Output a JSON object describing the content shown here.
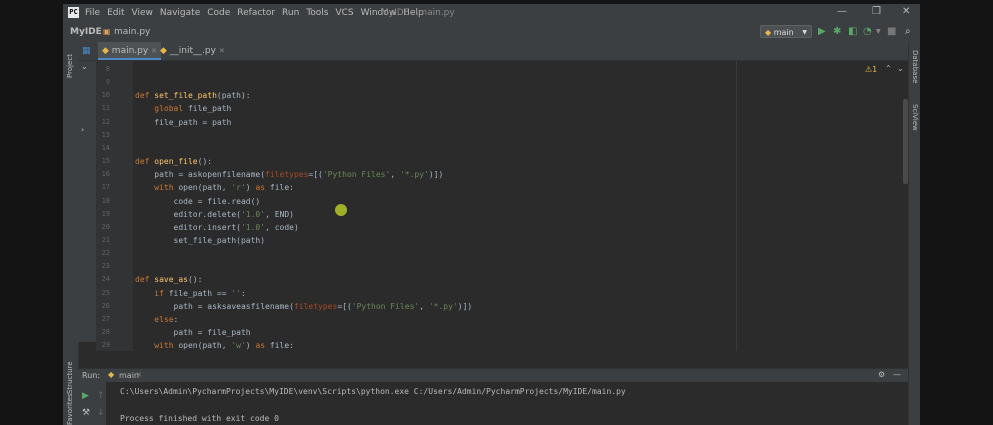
{
  "app": {
    "logo": "PC",
    "menu": [
      "File",
      "Edit",
      "View",
      "Navigate",
      "Code",
      "Refactor",
      "Run",
      "Tools",
      "VCS",
      "Window",
      "Help"
    ],
    "window_title": "MyIDE - main.py",
    "controls": {
      "minimize": "—",
      "maximize": "❐",
      "close": "✕"
    }
  },
  "navbar": {
    "project": "MyIDE",
    "file": "main.py",
    "run_config": "main"
  },
  "side": {
    "left_top": "Project",
    "left_bottom_1": "Structure",
    "left_bottom_2": "Favorites",
    "right_1": "Database",
    "right_2": "SciView"
  },
  "tabs": [
    {
      "label": "main.py"
    },
    {
      "label": "__init__.py"
    }
  ],
  "editor": {
    "inspection": "⚠1",
    "lines": [
      {
        "n": "8",
        "segs": []
      },
      {
        "n": "9",
        "segs": []
      },
      {
        "n": "10",
        "segs": [
          {
            "t": "def ",
            "c": "kw"
          },
          {
            "t": "set_file_path",
            "c": "fn"
          },
          {
            "t": "(path):",
            "c": ""
          }
        ]
      },
      {
        "n": "11",
        "segs": [
          {
            "t": "    ",
            "c": ""
          },
          {
            "t": "global ",
            "c": "kw"
          },
          {
            "t": "file_path",
            "c": ""
          }
        ]
      },
      {
        "n": "12",
        "segs": [
          {
            "t": "    file_path = path",
            "c": ""
          }
        ]
      },
      {
        "n": "13",
        "segs": []
      },
      {
        "n": "14",
        "segs": []
      },
      {
        "n": "15",
        "segs": [
          {
            "t": "def ",
            "c": "kw"
          },
          {
            "t": "open_file",
            "c": "fn"
          },
          {
            "t": "():",
            "c": ""
          }
        ]
      },
      {
        "n": "16",
        "segs": [
          {
            "t": "    path = askopenfilename(",
            "c": ""
          },
          {
            "t": "filetypes",
            "c": "pm"
          },
          {
            "t": "=[(",
            "c": ""
          },
          {
            "t": "'Python Files'",
            "c": "st"
          },
          {
            "t": ", ",
            "c": ""
          },
          {
            "t": "'*.py'",
            "c": "st"
          },
          {
            "t": ")])",
            "c": ""
          }
        ]
      },
      {
        "n": "17",
        "segs": [
          {
            "t": "    ",
            "c": ""
          },
          {
            "t": "with ",
            "c": "kw"
          },
          {
            "t": "open(path, ",
            "c": ""
          },
          {
            "t": "'r'",
            "c": "st"
          },
          {
            "t": ") ",
            "c": ""
          },
          {
            "t": "as ",
            "c": "kw"
          },
          {
            "t": "file:",
            "c": ""
          }
        ]
      },
      {
        "n": "18",
        "segs": [
          {
            "t": "        code = file.read()",
            "c": ""
          }
        ]
      },
      {
        "n": "19",
        "segs": [
          {
            "t": "        editor.delete(",
            "c": ""
          },
          {
            "t": "'1.0'",
            "c": "st"
          },
          {
            "t": ", END)",
            "c": ""
          }
        ]
      },
      {
        "n": "20",
        "segs": [
          {
            "t": "        editor.insert(",
            "c": ""
          },
          {
            "t": "'1.0'",
            "c": "st"
          },
          {
            "t": ", code)",
            "c": ""
          }
        ]
      },
      {
        "n": "21",
        "segs": [
          {
            "t": "        set_file_path(path)",
            "c": ""
          }
        ]
      },
      {
        "n": "22",
        "segs": []
      },
      {
        "n": "23",
        "segs": []
      },
      {
        "n": "24",
        "segs": [
          {
            "t": "def ",
            "c": "kw"
          },
          {
            "t": "save_as",
            "c": "fn"
          },
          {
            "t": "():",
            "c": ""
          }
        ]
      },
      {
        "n": "25",
        "segs": [
          {
            "t": "    ",
            "c": ""
          },
          {
            "t": "if ",
            "c": "kw"
          },
          {
            "t": "file_path == ",
            "c": ""
          },
          {
            "t": "''",
            "c": "st"
          },
          {
            "t": ":",
            "c": ""
          }
        ]
      },
      {
        "n": "26",
        "segs": [
          {
            "t": "        path = asksaveasfilename(",
            "c": ""
          },
          {
            "t": "filetypes",
            "c": "pm"
          },
          {
            "t": "=[(",
            "c": ""
          },
          {
            "t": "'Python Files'",
            "c": "st"
          },
          {
            "t": ", ",
            "c": ""
          },
          {
            "t": "'*.py'",
            "c": "st"
          },
          {
            "t": ")])",
            "c": ""
          }
        ]
      },
      {
        "n": "27",
        "segs": [
          {
            "t": "    ",
            "c": ""
          },
          {
            "t": "else",
            "c": "kw"
          },
          {
            "t": ":",
            "c": ""
          }
        ]
      },
      {
        "n": "28",
        "segs": [
          {
            "t": "        path = file_path",
            "c": ""
          }
        ]
      },
      {
        "n": "29",
        "segs": [
          {
            "t": "    ",
            "c": ""
          },
          {
            "t": "with ",
            "c": "kw"
          },
          {
            "t": "open(path, ",
            "c": ""
          },
          {
            "t": "'w'",
            "c": "st"
          },
          {
            "t": ") ",
            "c": ""
          },
          {
            "t": "as ",
            "c": "kw"
          },
          {
            "t": "file:",
            "c": ""
          }
        ]
      }
    ]
  },
  "run": {
    "label": "Run:",
    "tab": "main",
    "command": "C:\\Users\\Admin\\PycharmProjects\\MyIDE\\venv\\Scripts\\python.exe C:/Users/Admin/PycharmProjects/MyIDE/main.py",
    "result": "Process finished with exit code 0"
  }
}
